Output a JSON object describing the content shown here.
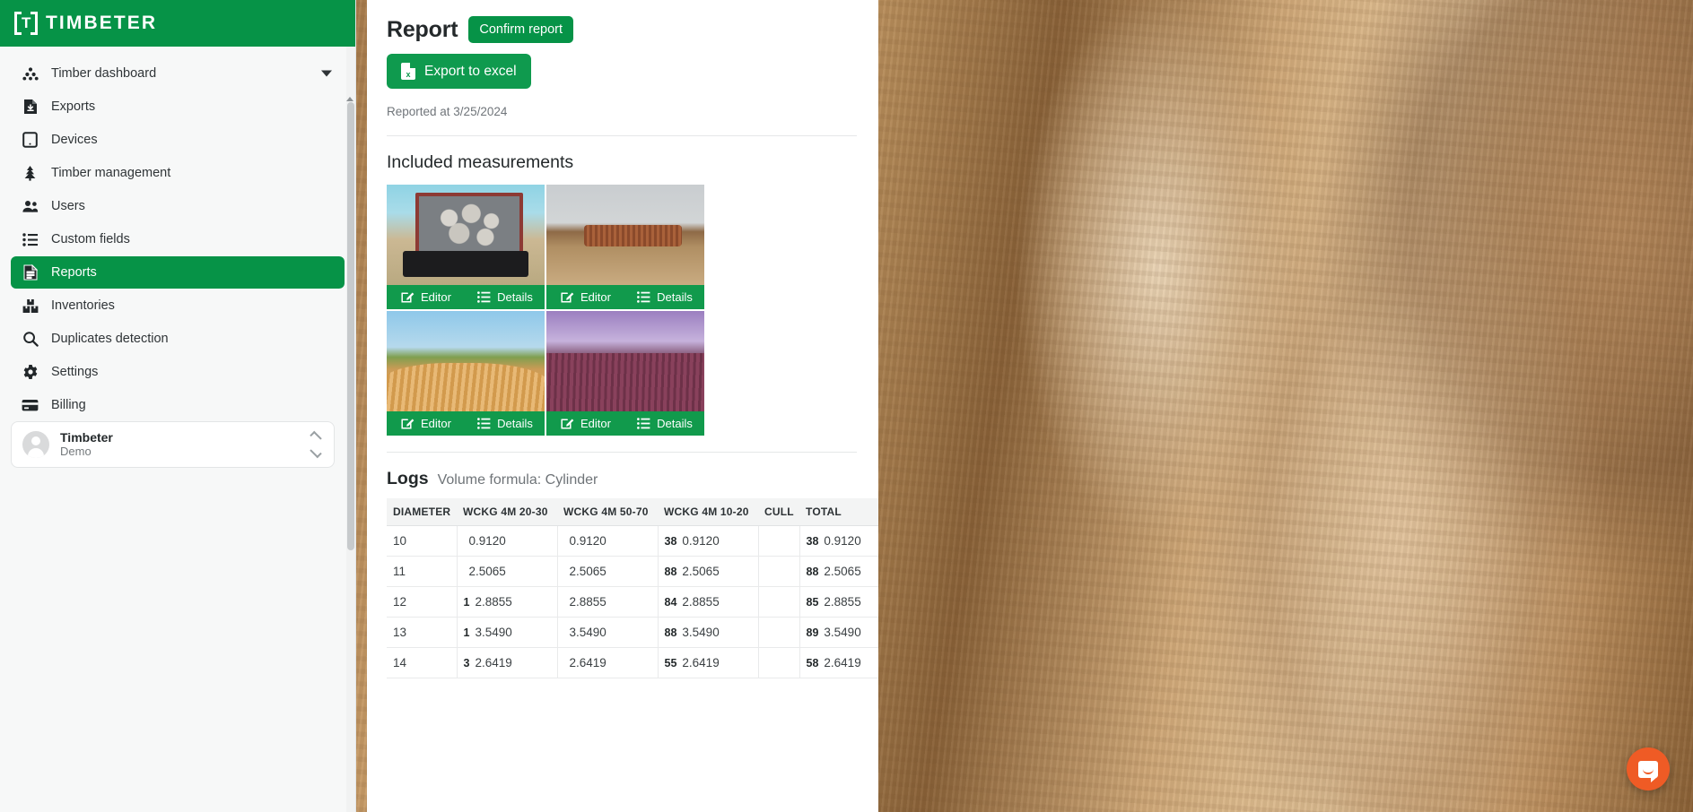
{
  "brand": {
    "name": "TIMBETER",
    "mark_letter": "T"
  },
  "sidebar": {
    "items": [
      {
        "label": "Timber dashboard",
        "icon": "stack-icon",
        "active": false,
        "chevron": true
      },
      {
        "label": "Exports",
        "icon": "file-download-icon",
        "active": false,
        "chevron": false
      },
      {
        "label": "Devices",
        "icon": "tablet-icon",
        "active": false,
        "chevron": false
      },
      {
        "label": "Timber management",
        "icon": "tree-icon",
        "active": false,
        "chevron": false
      },
      {
        "label": "Users",
        "icon": "users-icon",
        "active": false,
        "chevron": false
      },
      {
        "label": "Custom fields",
        "icon": "list-icon",
        "active": false,
        "chevron": false
      },
      {
        "label": "Reports",
        "icon": "document-icon",
        "active": true,
        "chevron": false
      },
      {
        "label": "Inventories",
        "icon": "boxes-icon",
        "active": false,
        "chevron": false
      },
      {
        "label": "Duplicates detection",
        "icon": "search-icon",
        "active": false,
        "chevron": false
      },
      {
        "label": "Settings",
        "icon": "gear-icon",
        "active": false,
        "chevron": false
      },
      {
        "label": "Billing",
        "icon": "credit-card-icon",
        "active": false,
        "chevron": false
      }
    ],
    "user": {
      "name": "Timbeter",
      "role": "Demo"
    }
  },
  "report": {
    "title": "Report",
    "confirm_label": "Confirm report",
    "export_label": "Export to excel",
    "reported_at": "Reported at 3/25/2024",
    "measurements_title": "Included measurements",
    "card_action_editor": "Editor",
    "card_action_details": "Details",
    "measurements": [
      {
        "scene": "truck-load-logs"
      },
      {
        "scene": "log-pile-quarry"
      },
      {
        "scene": "log-pile-field"
      },
      {
        "scene": "log-pile-purple"
      }
    ]
  },
  "logs": {
    "title": "Logs",
    "subtitle": "Volume formula: Cylinder",
    "columns": [
      "DIAMETER",
      "WCKG 4M 20-30",
      "WCKG 4M 50-70",
      "WCKG 4M 10-20",
      "CULL",
      "TOTAL"
    ],
    "rows": [
      {
        "diameter": "10",
        "c1": {
          "count": "",
          "value": "0.9120"
        },
        "c2": {
          "count": "",
          "value": "0.9120"
        },
        "c3": {
          "count": "38",
          "value": "0.9120"
        },
        "cull": "",
        "total": {
          "count": "38",
          "value": "0.9120"
        }
      },
      {
        "diameter": "11",
        "c1": {
          "count": "",
          "value": "2.5065"
        },
        "c2": {
          "count": "",
          "value": "2.5065"
        },
        "c3": {
          "count": "88",
          "value": "2.5065"
        },
        "cull": "",
        "total": {
          "count": "88",
          "value": "2.5065"
        }
      },
      {
        "diameter": "12",
        "c1": {
          "count": "1",
          "value": "2.8855"
        },
        "c2": {
          "count": "",
          "value": "2.8855"
        },
        "c3": {
          "count": "84",
          "value": "2.8855"
        },
        "cull": "",
        "total": {
          "count": "85",
          "value": "2.8855"
        }
      },
      {
        "diameter": "13",
        "c1": {
          "count": "1",
          "value": "3.5490"
        },
        "c2": {
          "count": "",
          "value": "3.5490"
        },
        "c3": {
          "count": "88",
          "value": "3.5490"
        },
        "cull": "",
        "total": {
          "count": "89",
          "value": "3.5490"
        }
      },
      {
        "diameter": "14",
        "c1": {
          "count": "3",
          "value": "2.6419"
        },
        "c2": {
          "count": "",
          "value": "2.6419"
        },
        "c3": {
          "count": "55",
          "value": "2.6419"
        },
        "cull": "",
        "total": {
          "count": "58",
          "value": "2.6419"
        }
      }
    ]
  },
  "chat": {
    "label": "Intercom messenger"
  },
  "colors": {
    "brand_green": "#069347",
    "button_green": "#0f9a4e",
    "card_green": "#119a4c",
    "intercom_orange": "#ef5b25"
  }
}
